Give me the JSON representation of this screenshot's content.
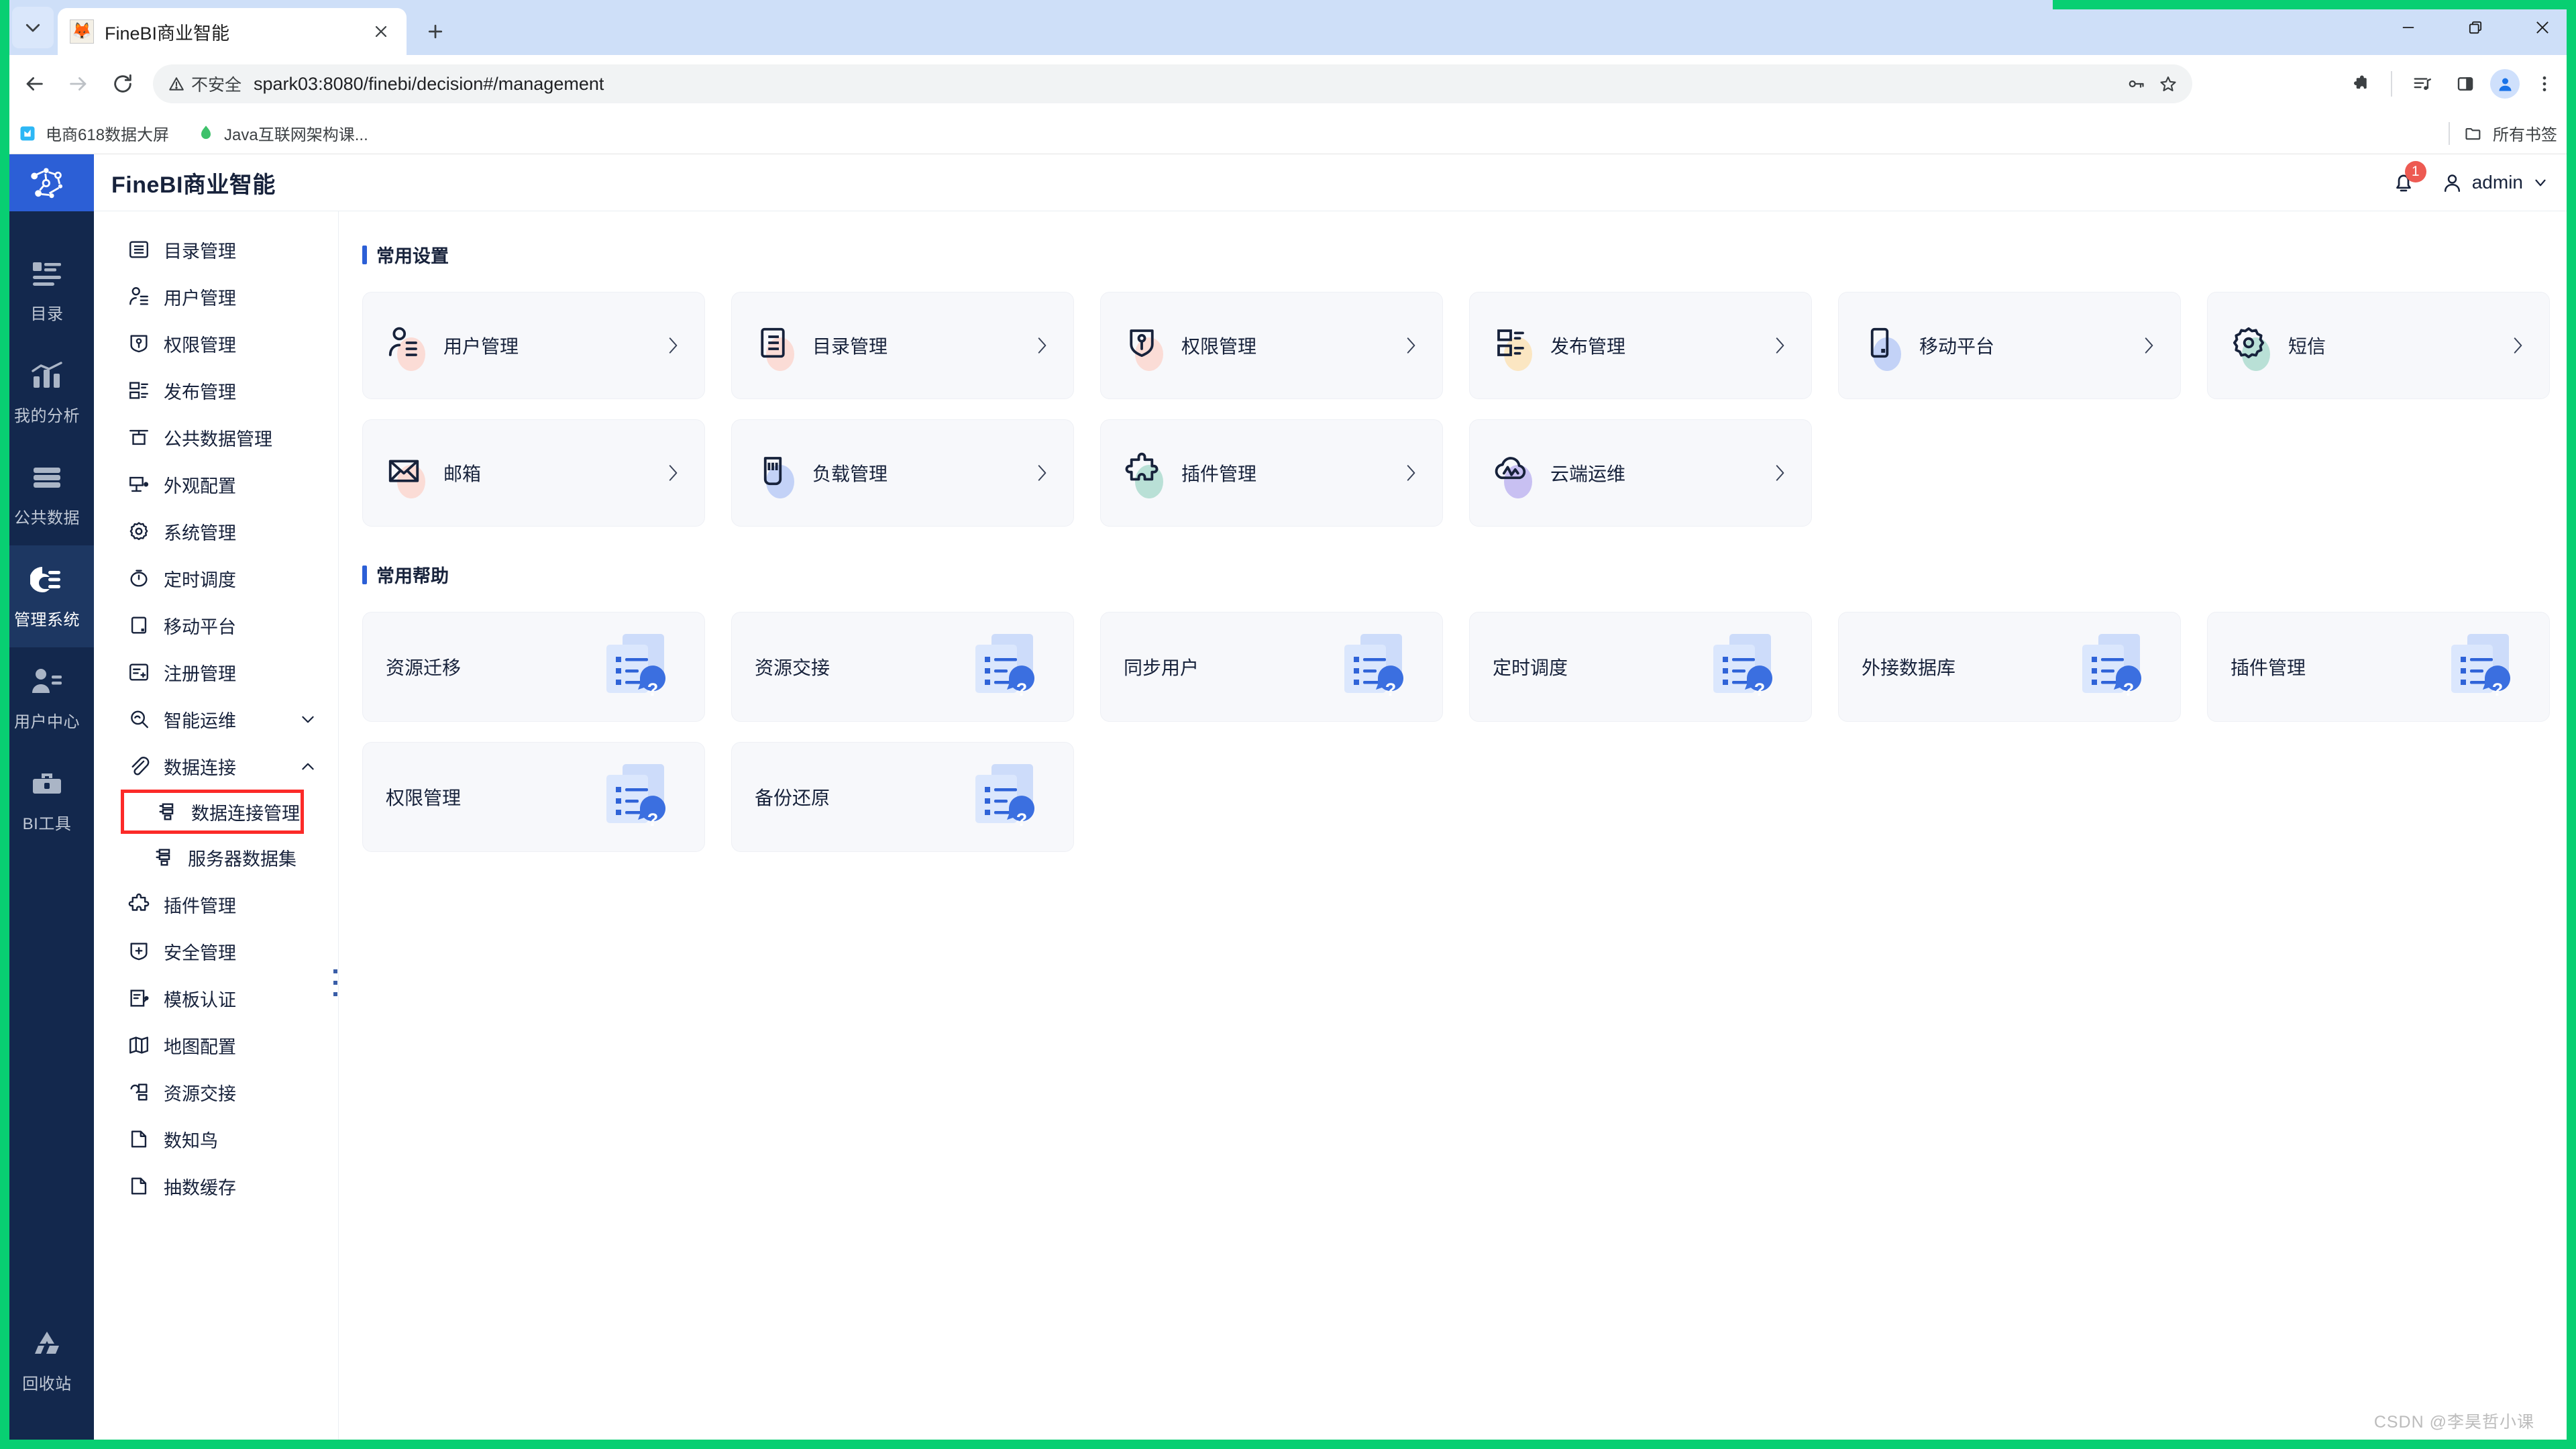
{
  "browser": {
    "tab": {
      "title": "FineBI商业智能",
      "favicon": "fox-favicon"
    },
    "new_tab_label": "+",
    "omnibox": {
      "security_label": "不安全",
      "url": "spark03:8080/finebi/decision#/management"
    },
    "bookmarks": [
      {
        "label": "电商618数据大屏",
        "icon": "bookmark-chart-icon"
      },
      {
        "label": "Java互联网架构课...",
        "icon": "bookmark-leaf-icon"
      }
    ],
    "all_bookmarks_label": "所有书签",
    "window_controls": [
      "minimize",
      "maximize",
      "close"
    ]
  },
  "app": {
    "title": "FineBI商业智能",
    "notification_count": "1",
    "user_name": "admin"
  },
  "rail": {
    "items": [
      {
        "label": "目录",
        "icon": "list-icon",
        "active": false
      },
      {
        "label": "我的分析",
        "icon": "chart-icon",
        "active": false
      },
      {
        "label": "公共数据",
        "icon": "database-icon",
        "active": false
      },
      {
        "label": "管理系统",
        "icon": "gear-settings-icon",
        "active": true
      },
      {
        "label": "用户中心",
        "icon": "user-card-icon",
        "active": false
      },
      {
        "label": "BI工具",
        "icon": "toolbox-icon",
        "active": false
      }
    ],
    "bottom": {
      "label": "回收站",
      "icon": "recycle-icon"
    }
  },
  "menu": {
    "items": [
      {
        "label": "目录管理",
        "icon": "catalog-icon",
        "level": 0,
        "chevron": ""
      },
      {
        "label": "用户管理",
        "icon": "user-manage-icon",
        "level": 0,
        "chevron": ""
      },
      {
        "label": "权限管理",
        "icon": "permission-shield-icon",
        "level": 0,
        "chevron": ""
      },
      {
        "label": "发布管理",
        "icon": "publish-icon",
        "level": 0,
        "chevron": ""
      },
      {
        "label": "公共数据管理",
        "icon": "public-data-icon",
        "level": 0,
        "chevron": ""
      },
      {
        "label": "外观配置",
        "icon": "appearance-icon",
        "level": 0,
        "chevron": ""
      },
      {
        "label": "系统管理",
        "icon": "gear-icon",
        "level": 0,
        "chevron": ""
      },
      {
        "label": "定时调度",
        "icon": "clock-icon",
        "level": 0,
        "chevron": ""
      },
      {
        "label": "移动平台",
        "icon": "mobile-icon",
        "level": 0,
        "chevron": ""
      },
      {
        "label": "注册管理",
        "icon": "register-icon",
        "level": 0,
        "chevron": ""
      },
      {
        "label": "智能运维",
        "icon": "ops-icon",
        "level": 0,
        "chevron": "down"
      },
      {
        "label": "数据连接",
        "icon": "link-icon",
        "level": 0,
        "chevron": "up"
      },
      {
        "label": "数据连接管理",
        "icon": "db-connection-icon",
        "level": 1,
        "chevron": "",
        "highlighted": true
      },
      {
        "label": "服务器数据集",
        "icon": "server-dataset-icon",
        "level": 1,
        "chevron": ""
      },
      {
        "label": "插件管理",
        "icon": "puzzle-icon",
        "level": 0,
        "chevron": ""
      },
      {
        "label": "安全管理",
        "icon": "security-shield-icon",
        "level": 0,
        "chevron": ""
      },
      {
        "label": "模板认证",
        "icon": "template-auth-icon",
        "level": 0,
        "chevron": ""
      },
      {
        "label": "地图配置",
        "icon": "map-icon",
        "level": 0,
        "chevron": ""
      },
      {
        "label": "资源交接",
        "icon": "resource-handover-icon",
        "level": 0,
        "chevron": ""
      },
      {
        "label": "数知鸟",
        "icon": "page-icon",
        "level": 0,
        "chevron": ""
      },
      {
        "label": "抽数缓存",
        "icon": "page-icon",
        "level": 0,
        "chevron": ""
      }
    ]
  },
  "content": {
    "settings_section": {
      "title": "常用设置",
      "cards": [
        {
          "label": "用户管理",
          "icon": "user-manage-icon",
          "blob": "#fbdcd6"
        },
        {
          "label": "目录管理",
          "icon": "catalog-icon",
          "blob": "#fbdcd6"
        },
        {
          "label": "权限管理",
          "icon": "permission-shield-icon",
          "blob": "#fbdcd6"
        },
        {
          "label": "发布管理",
          "icon": "publish-icon",
          "blob": "#fbe6c2"
        },
        {
          "label": "移动平台",
          "icon": "mobile-icon",
          "blob": "#c3d2f7"
        },
        {
          "label": "短信",
          "icon": "sms-gear-icon",
          "blob": "#b9e0d6"
        },
        {
          "label": "邮箱",
          "icon": "mail-icon",
          "blob": "#fbdcd6"
        },
        {
          "label": "负载管理",
          "icon": "load-icon",
          "blob": "#c3d2f7"
        },
        {
          "label": "插件管理",
          "icon": "puzzle-icon",
          "blob": "#b9e0d6"
        },
        {
          "label": "云端运维",
          "icon": "cloud-ops-icon",
          "blob": "#c8c0f2"
        }
      ]
    },
    "help_section": {
      "title": "常用帮助",
      "cards": [
        {
          "label": "资源迁移",
          "icon": "doc-help-icon"
        },
        {
          "label": "资源交接",
          "icon": "doc-help-icon"
        },
        {
          "label": "同步用户",
          "icon": "doc-help-icon"
        },
        {
          "label": "定时调度",
          "icon": "doc-help-icon"
        },
        {
          "label": "外接数据库",
          "icon": "doc-help-icon"
        },
        {
          "label": "插件管理",
          "icon": "doc-help-icon"
        },
        {
          "label": "权限管理",
          "icon": "doc-help-icon"
        },
        {
          "label": "备份还原",
          "icon": "doc-help-icon"
        }
      ]
    }
  },
  "watermark": "CSDN @李昊哲小课",
  "colors": {
    "brand_blue": "#2c5fd6",
    "rail_bg": "#13284d",
    "rail_active": "#1d3762",
    "card_bg": "#f7f8fb",
    "highlight_red": "#fc2a28",
    "badge_red": "#ed5a52",
    "recording_green": "#08cf72"
  }
}
